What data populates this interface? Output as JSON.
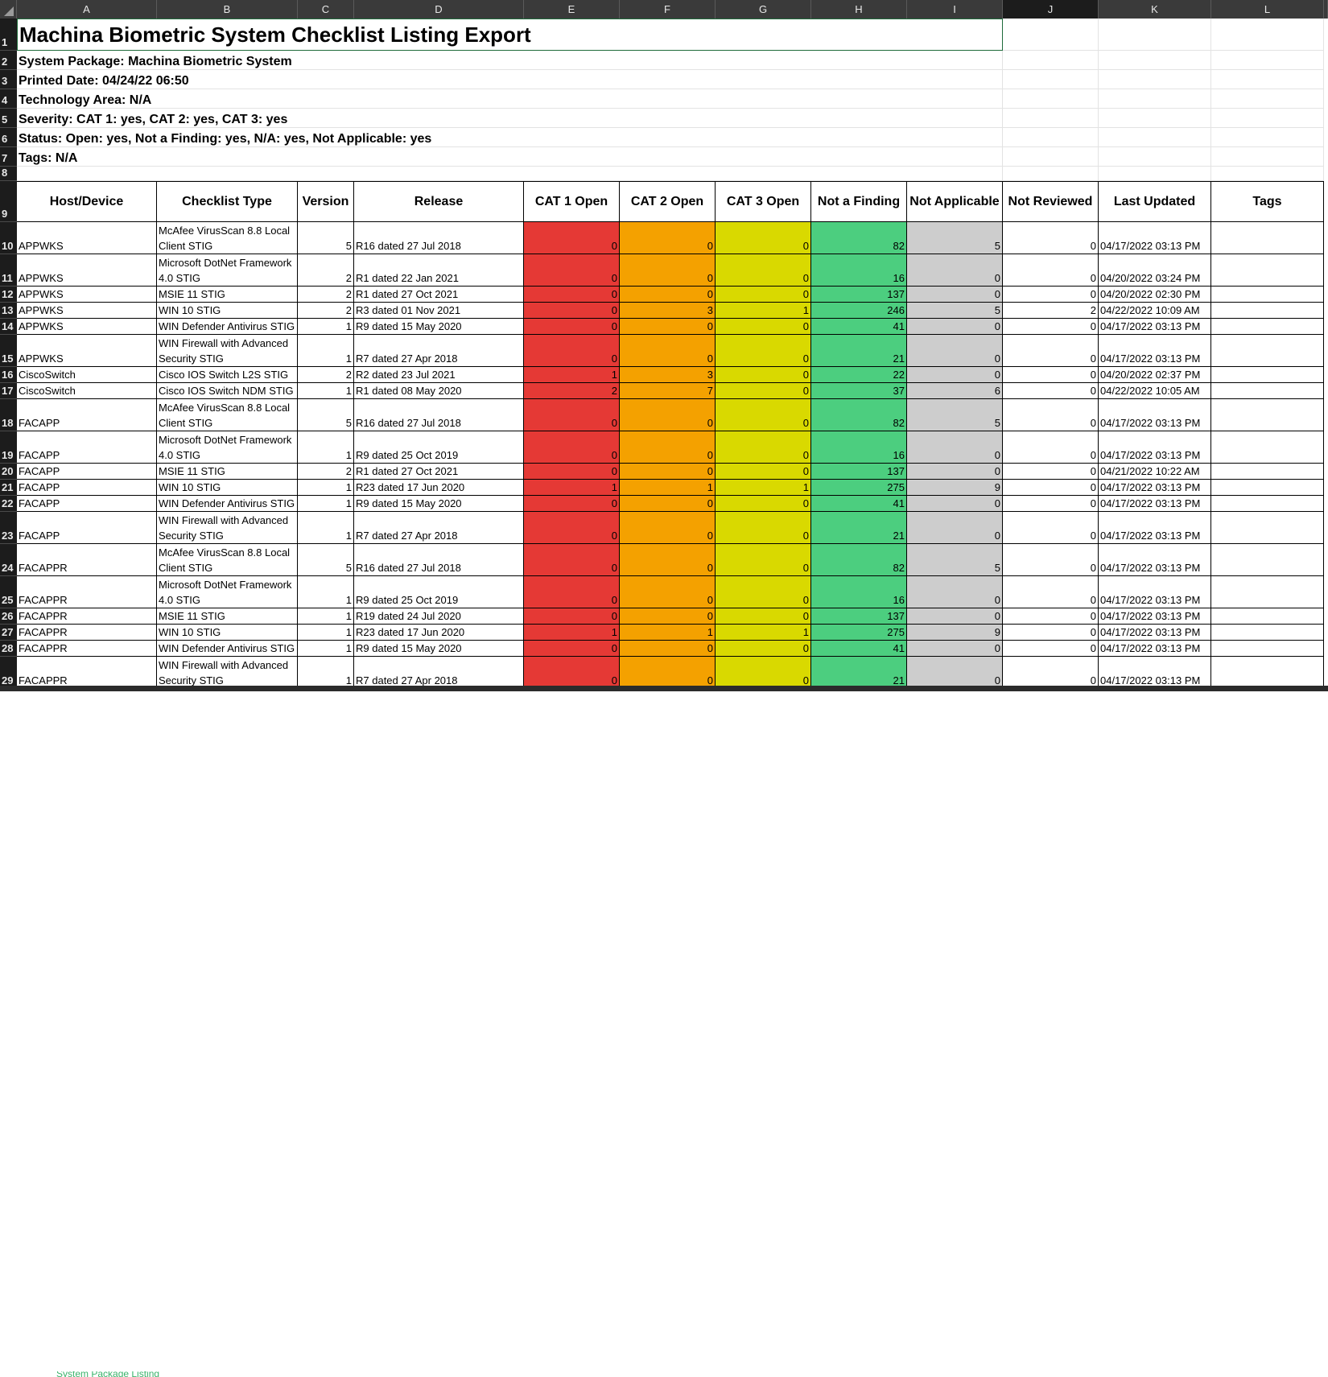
{
  "columns": [
    "A",
    "B",
    "C",
    "D",
    "E",
    "F",
    "G",
    "H",
    "I",
    "J",
    "K",
    "L"
  ],
  "title": "Machina Biometric System Checklist Listing Export",
  "info_lines": [
    "System Package: Machina Biometric System",
    "Printed Date: 04/24/22 06:50",
    "Technology Area: N/A",
    "Severity: CAT 1: yes, CAT 2: yes, CAT 3: yes",
    "Status: Open: yes, Not a Finding: yes, N/A: yes, Not Applicable: yes",
    "Tags: N/A"
  ],
  "headers": [
    "Host/Device",
    "Checklist Type",
    "Version",
    "Release",
    "CAT 1 Open",
    "CAT 2 Open",
    "CAT 3 Open",
    "Not a Finding",
    "Not Applicable",
    "Not Reviewed",
    "Last Updated",
    "Tags"
  ],
  "colors": {
    "cat1": "#e53935",
    "cat2": "#f4a100",
    "cat3": "#d9d900",
    "naf": "#4cce7f",
    "na": "#cdcdcd",
    "selected_border": "#1e6b3a"
  },
  "rows": [
    {
      "n": "10",
      "host": "APPWKS",
      "type": "McAfee VirusScan 8.8 Local Client STIG",
      "ver": "5",
      "rel": "R16 dated 27 Jul 2018",
      "c1": "0",
      "c2": "0",
      "c3": "0",
      "naf": "82",
      "na": "5",
      "nr": "0",
      "upd": "04/17/2022 03:13 PM"
    },
    {
      "n": "11",
      "host": "APPWKS",
      "type": "Microsoft DotNet Framework 4.0 STIG",
      "ver": "2",
      "rel": "R1 dated 22 Jan 2021",
      "c1": "0",
      "c2": "0",
      "c3": "0",
      "naf": "16",
      "na": "0",
      "nr": "0",
      "upd": "04/20/2022 03:24 PM"
    },
    {
      "n": "12",
      "host": "APPWKS",
      "type": "MSIE 11 STIG",
      "ver": "2",
      "rel": "R1 dated 27 Oct 2021",
      "c1": "0",
      "c2": "0",
      "c3": "0",
      "naf": "137",
      "na": "0",
      "nr": "0",
      "upd": "04/20/2022 02:30 PM"
    },
    {
      "n": "13",
      "host": "APPWKS",
      "type": "WIN 10 STIG",
      "ver": "2",
      "rel": "R3 dated 01 Nov 2021",
      "c1": "0",
      "c2": "3",
      "c3": "1",
      "naf": "246",
      "na": "5",
      "nr": "2",
      "upd": "04/22/2022 10:09 AM"
    },
    {
      "n": "14",
      "host": "APPWKS",
      "type": "WIN Defender Antivirus STIG",
      "ver": "1",
      "rel": "R9 dated 15 May 2020",
      "c1": "0",
      "c2": "0",
      "c3": "0",
      "naf": "41",
      "na": "0",
      "nr": "0",
      "upd": "04/17/2022 03:13 PM"
    },
    {
      "n": "15",
      "host": "APPWKS",
      "type": "WIN Firewall with Advanced Security STIG",
      "ver": "1",
      "rel": "R7 dated 27 Apr 2018",
      "c1": "0",
      "c2": "0",
      "c3": "0",
      "naf": "21",
      "na": "0",
      "nr": "0",
      "upd": "04/17/2022 03:13 PM"
    },
    {
      "n": "16",
      "host": "CiscoSwitch",
      "type": "Cisco IOS Switch L2S STIG",
      "ver": "2",
      "rel": "R2 dated 23 Jul 2021",
      "c1": "1",
      "c2": "3",
      "c3": "0",
      "naf": "22",
      "na": "0",
      "nr": "0",
      "upd": "04/20/2022 02:37 PM"
    },
    {
      "n": "17",
      "host": "CiscoSwitch",
      "type": "Cisco IOS Switch NDM STIG",
      "ver": "1",
      "rel": "R1 dated 08 May 2020",
      "c1": "2",
      "c2": "7",
      "c3": "0",
      "naf": "37",
      "na": "6",
      "nr": "0",
      "upd": "04/22/2022 10:05 AM"
    },
    {
      "n": "18",
      "host": "FACAPP",
      "type": "McAfee VirusScan 8.8 Local Client STIG",
      "ver": "5",
      "rel": "R16 dated 27 Jul 2018",
      "c1": "0",
      "c2": "0",
      "c3": "0",
      "naf": "82",
      "na": "5",
      "nr": "0",
      "upd": "04/17/2022 03:13 PM"
    },
    {
      "n": "19",
      "host": "FACAPP",
      "type": "Microsoft DotNet Framework 4.0 STIG",
      "ver": "1",
      "rel": "R9 dated 25 Oct 2019",
      "c1": "0",
      "c2": "0",
      "c3": "0",
      "naf": "16",
      "na": "0",
      "nr": "0",
      "upd": "04/17/2022 03:13 PM"
    },
    {
      "n": "20",
      "host": "FACAPP",
      "type": "MSIE 11 STIG",
      "ver": "2",
      "rel": "R1 dated 27 Oct 2021",
      "c1": "0",
      "c2": "0",
      "c3": "0",
      "naf": "137",
      "na": "0",
      "nr": "0",
      "upd": "04/21/2022 10:22 AM"
    },
    {
      "n": "21",
      "host": "FACAPP",
      "type": "WIN 10 STIG",
      "ver": "1",
      "rel": "R23 dated 17 Jun 2020",
      "c1": "1",
      "c2": "1",
      "c3": "1",
      "naf": "275",
      "na": "9",
      "nr": "0",
      "upd": "04/17/2022 03:13 PM"
    },
    {
      "n": "22",
      "host": "FACAPP",
      "type": "WIN Defender Antivirus STIG",
      "ver": "1",
      "rel": "R9 dated 15 May 2020",
      "c1": "0",
      "c2": "0",
      "c3": "0",
      "naf": "41",
      "na": "0",
      "nr": "0",
      "upd": "04/17/2022 03:13 PM"
    },
    {
      "n": "23",
      "host": "FACAPP",
      "type": "WIN Firewall with Advanced Security STIG",
      "ver": "1",
      "rel": "R7 dated 27 Apr 2018",
      "c1": "0",
      "c2": "0",
      "c3": "0",
      "naf": "21",
      "na": "0",
      "nr": "0",
      "upd": "04/17/2022 03:13 PM"
    },
    {
      "n": "24",
      "host": "FACAPPR",
      "type": "McAfee VirusScan 8.8 Local Client STIG",
      "ver": "5",
      "rel": "R16 dated 27 Jul 2018",
      "c1": "0",
      "c2": "0",
      "c3": "0",
      "naf": "82",
      "na": "5",
      "nr": "0",
      "upd": "04/17/2022 03:13 PM"
    },
    {
      "n": "25",
      "host": "FACAPPR",
      "type": "Microsoft DotNet Framework 4.0 STIG",
      "ver": "1",
      "rel": "R9 dated 25 Oct 2019",
      "c1": "0",
      "c2": "0",
      "c3": "0",
      "naf": "16",
      "na": "0",
      "nr": "0",
      "upd": "04/17/2022 03:13 PM"
    },
    {
      "n": "26",
      "host": "FACAPPR",
      "type": "MSIE 11 STIG",
      "ver": "1",
      "rel": "R19 dated 24 Jul 2020",
      "c1": "0",
      "c2": "0",
      "c3": "0",
      "naf": "137",
      "na": "0",
      "nr": "0",
      "upd": "04/17/2022 03:13 PM"
    },
    {
      "n": "27",
      "host": "FACAPPR",
      "type": "WIN 10 STIG",
      "ver": "1",
      "rel": "R23 dated 17 Jun 2020",
      "c1": "1",
      "c2": "1",
      "c3": "1",
      "naf": "275",
      "na": "9",
      "nr": "0",
      "upd": "04/17/2022 03:13 PM"
    },
    {
      "n": "28",
      "host": "FACAPPR",
      "type": "WIN Defender Antivirus STIG",
      "ver": "1",
      "rel": "R9 dated 15 May 2020",
      "c1": "0",
      "c2": "0",
      "c3": "0",
      "naf": "41",
      "na": "0",
      "nr": "0",
      "upd": "04/17/2022 03:13 PM"
    },
    {
      "n": "29",
      "host": "FACAPPR",
      "type": "WIN Firewall with Advanced Security STIG",
      "ver": "1",
      "rel": "R7 dated 27 Apr 2018",
      "c1": "0",
      "c2": "0",
      "c3": "0",
      "naf": "21",
      "na": "0",
      "nr": "0",
      "upd": "04/17/2022 03:13 PM"
    }
  ],
  "sheet_tab_label": "System Package Listing"
}
